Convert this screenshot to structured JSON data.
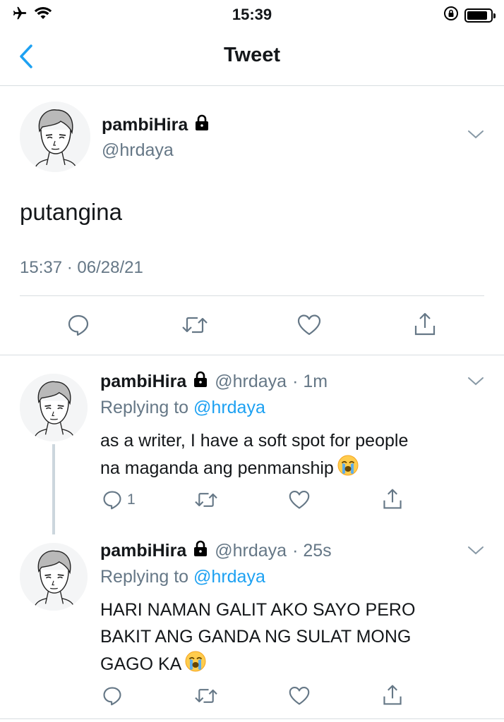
{
  "status_bar": {
    "time": "15:39"
  },
  "nav": {
    "title": "Tweet"
  },
  "main_tweet": {
    "name": "pambiHira",
    "handle": "@hrdaya",
    "text": "putangina",
    "timestamp": "15:37 · 06/28/21"
  },
  "replies": [
    {
      "name": "pambiHira",
      "handle": "@hrdaya",
      "time": "· 1m",
      "replying_label": "Replying to",
      "replying_to": "@hrdaya",
      "text_lines": [
        "as a writer, I have a soft spot for people",
        "na maganda ang penmanship"
      ],
      "reply_count": "1"
    },
    {
      "name": "pambiHira",
      "handle": "@hrdaya",
      "time": "· 25s",
      "replying_label": "Replying to",
      "replying_to": "@hrdaya",
      "text_lines": [
        "HARI NAMAN GALIT AKO SAYO PERO",
        "BAKIT ANG GANDA NG SULAT MONG",
        "GAGO KA"
      ],
      "reply_count": ""
    }
  ],
  "icons": {
    "status": [
      "airplane-icon",
      "wifi-icon",
      "orientation-lock-icon",
      "battery-icon"
    ],
    "nav": [
      "back-chevron-icon"
    ],
    "actions": [
      "reply-icon",
      "retweet-icon",
      "like-icon",
      "share-icon"
    ],
    "misc": [
      "lock-icon",
      "chevron-down-icon",
      "loudly-crying-face-emoji"
    ]
  },
  "colors": {
    "accent": "#1da1f2",
    "secondary_text": "#657786",
    "divider": "#d8dde1"
  }
}
